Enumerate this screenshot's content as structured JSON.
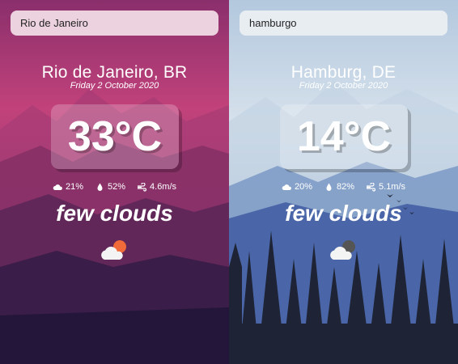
{
  "panels": [
    {
      "search": {
        "value": "Rio de Janeiro"
      },
      "city": "Rio de Janeiro, BR",
      "date": "Friday 2 October 2020",
      "temperature": "33°C",
      "clouds": "21%",
      "humidity": "52%",
      "wind": "4.6m/s",
      "description": "few clouds",
      "icon": "few-clouds-day-icon",
      "colors": {
        "sky_top": "#8f2f6e",
        "sky_mid": "#c8447d",
        "sun": "#f06a3a"
      }
    },
    {
      "search": {
        "value": "hamburgo"
      },
      "city": "Hamburg, DE",
      "date": "Friday 2 October 2020",
      "temperature": "14°C",
      "clouds": "20%",
      "humidity": "82%",
      "wind": "5.1m/s",
      "description": "few clouds",
      "icon": "few-clouds-night-icon",
      "colors": {
        "sky_top": "#b5cbe0",
        "sky_mid": "#dbe6ef",
        "moon": "#555555"
      }
    }
  ]
}
